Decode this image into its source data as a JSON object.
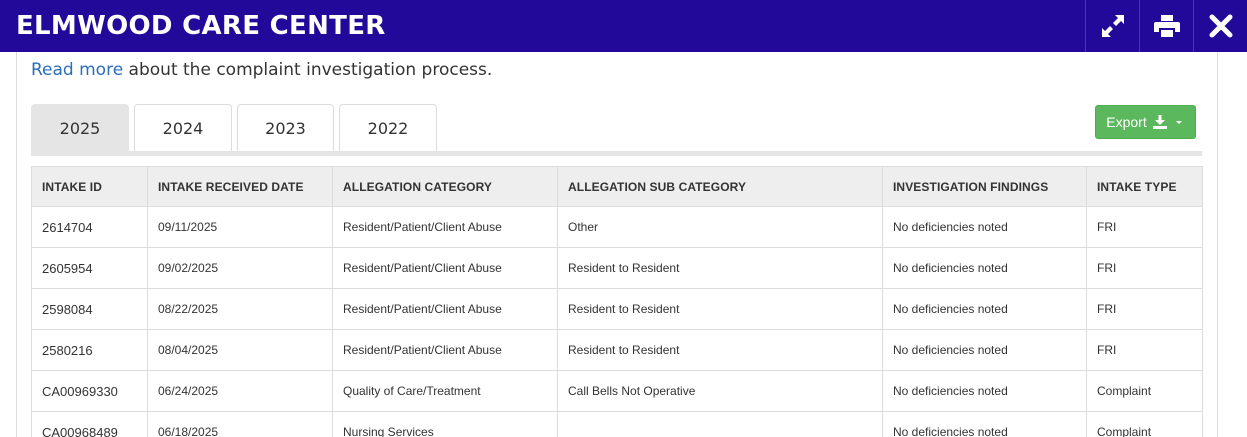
{
  "header": {
    "title": "ELMWOOD CARE CENTER"
  },
  "intro": {
    "link_text": "Read more",
    "rest_text": " about the complaint investigation process."
  },
  "tabs": [
    {
      "label": "2025",
      "active": true
    },
    {
      "label": "2024",
      "active": false
    },
    {
      "label": "2023",
      "active": false
    },
    {
      "label": "2022",
      "active": false
    }
  ],
  "export": {
    "label": "Export"
  },
  "table": {
    "columns": [
      "INTAKE ID",
      "INTAKE RECEIVED DATE",
      "ALLEGATION CATEGORY",
      "ALLEGATION SUB CATEGORY",
      "INVESTIGATION FINDINGS",
      "INTAKE TYPE"
    ],
    "rows": [
      [
        "2614704",
        "09/11/2025",
        "Resident/Patient/Client Abuse",
        "Other",
        "No deficiencies noted",
        "FRI"
      ],
      [
        "2605954",
        "09/02/2025",
        "Resident/Patient/Client Abuse",
        "Resident to Resident",
        "No deficiencies noted",
        "FRI"
      ],
      [
        "2598084",
        "08/22/2025",
        "Resident/Patient/Client Abuse",
        "Resident to Resident",
        "No deficiencies noted",
        "FRI"
      ],
      [
        "2580216",
        "08/04/2025",
        "Resident/Patient/Client Abuse",
        "Resident to Resident",
        "No deficiencies noted",
        "FRI"
      ],
      [
        "CA00969330",
        "06/24/2025",
        "Quality of Care/Treatment",
        "Call Bells Not Operative",
        "No deficiencies noted",
        "Complaint"
      ],
      [
        "CA00968489",
        "06/18/2025",
        "Nursing Services",
        "",
        "No deficiencies noted",
        "Complaint"
      ]
    ]
  },
  "colors": {
    "header_bg": "#22099a",
    "export_bg": "#5cb85c",
    "link": "#2a6ebb"
  },
  "icons": {
    "expand": "expand-icon",
    "print": "print-icon",
    "close": "close-icon",
    "download": "download-icon",
    "caret": "caret-down-icon"
  }
}
